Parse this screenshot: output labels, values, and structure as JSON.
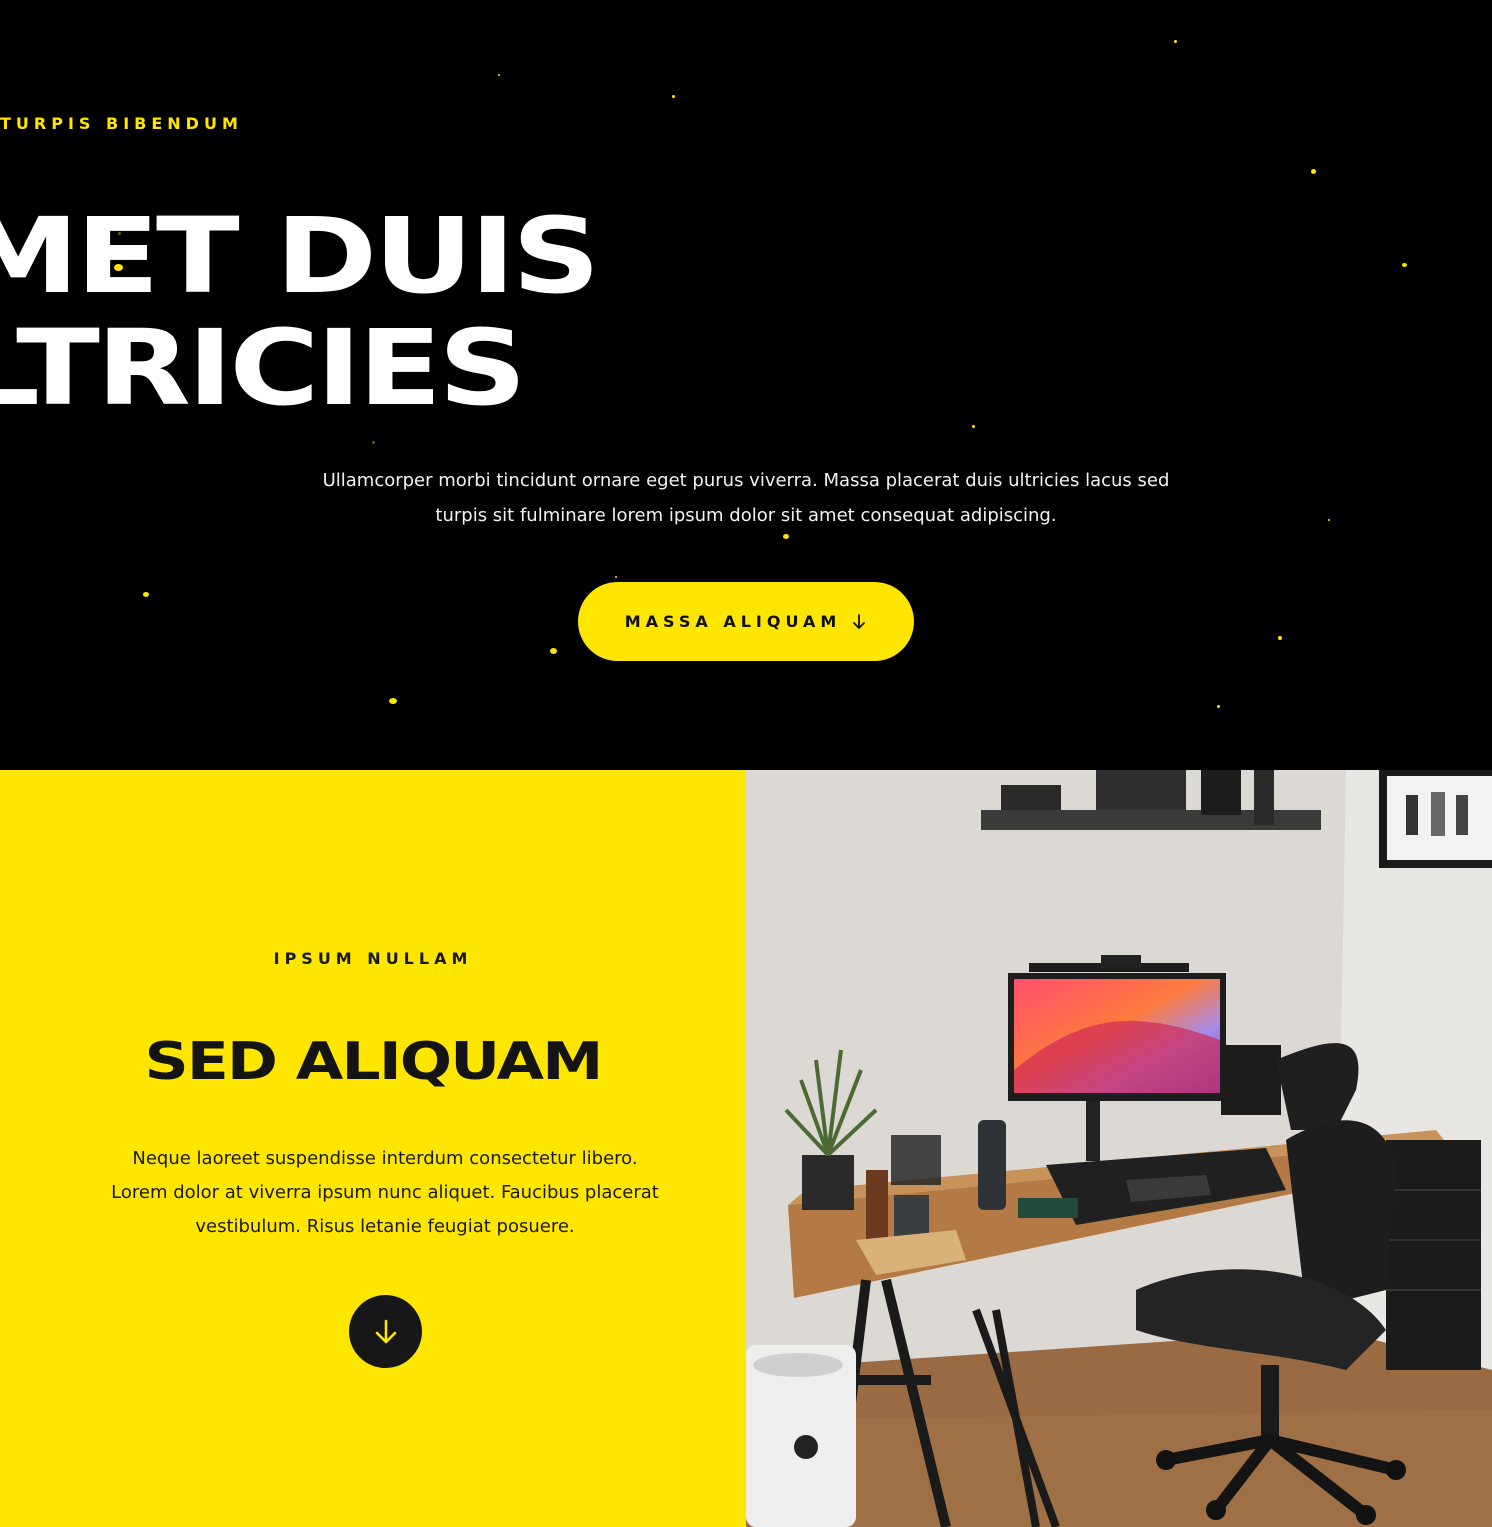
{
  "hero": {
    "eyebrow": "TURPIS BIBENDUM",
    "title_line1": "AMET DUIS",
    "title_line2": "ULTRICIES",
    "text_line1": "Ullamcorper morbi tincidunt ornare eget purus viverra. Massa placerat duis ultricies lacus sed",
    "text_line2": "turpis sit fulminare lorem ipsum dolor sit amet consequat adipiscing.",
    "cta_label": "MASSA ALIQUAM",
    "cta_icon": "arrow-down-icon"
  },
  "feature": {
    "eyebrow": "IPSUM NULLAM",
    "title": "SED ALIQUAM",
    "text_line1": "Neque laoreet suspendisse interdum consectetur libero.",
    "text_line2": "Lorem dolor at viverra ipsum nunc aliquet. Faucibus placerat",
    "text_line3": "vestibulum. Risus letanie feugiat posuere.",
    "button_icon": "arrow-down-icon"
  },
  "photo": {
    "description_icon": "desk-setup-photo"
  },
  "colors": {
    "accent": "#ffe600",
    "dark": "#000000",
    "ink": "#141414"
  }
}
